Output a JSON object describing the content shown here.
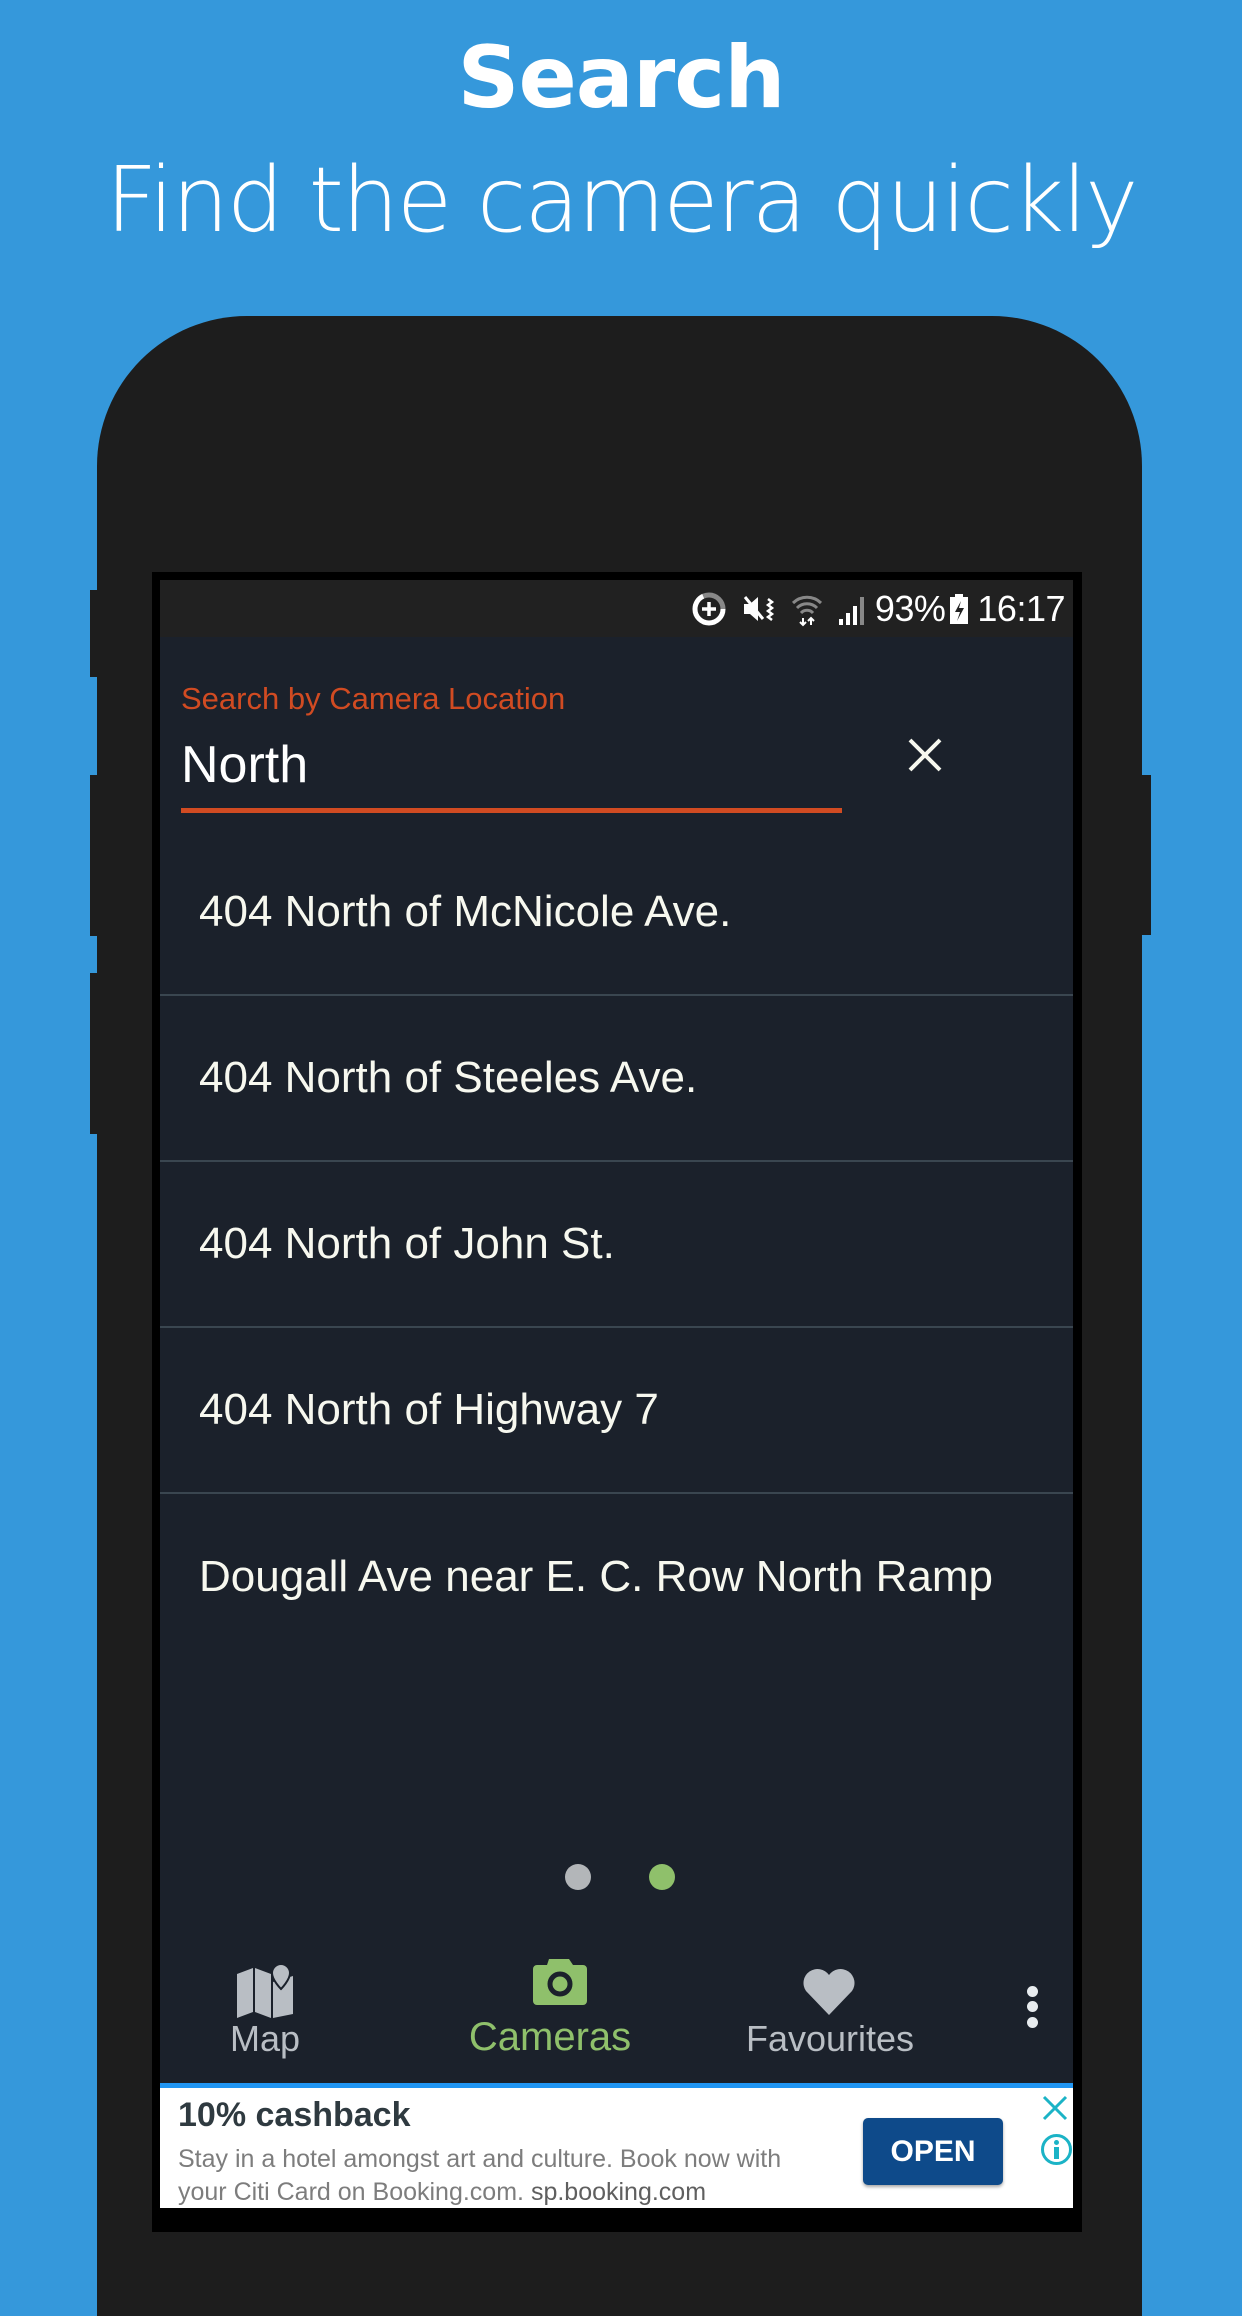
{
  "hero": {
    "title": "Search",
    "subtitle": "Find the camera quickly"
  },
  "status_bar": {
    "icons": [
      "data-saver-icon",
      "mute-vibrate-icon",
      "wifi-icon",
      "signal-icon",
      "battery-charging-icon"
    ],
    "battery": "93%",
    "time": "16:17"
  },
  "search": {
    "label": "Search by Camera Location",
    "value": "North",
    "clear_icon": "close-icon",
    "accent_color": "#d14b22"
  },
  "results": [
    "404 North of McNicole Ave.",
    "404 North of Steeles Ave.",
    "404 North of John St.",
    "404 North of Highway 7",
    "Dougall Ave near E. C. Row North Ramp"
  ],
  "pager": {
    "pages": 2,
    "active_page": 2,
    "inactive_color": "#b3b6b9",
    "active_color": "#8fc06b"
  },
  "bottom_nav": {
    "items": [
      {
        "label": "Map",
        "icon": "map-icon",
        "active": false
      },
      {
        "label": "Cameras",
        "icon": "camera-icon",
        "active": true
      },
      {
        "label": "Favourites",
        "icon": "heart-icon",
        "active": false
      }
    ],
    "more_icon": "more-vertical-icon"
  },
  "ad": {
    "title": "10% cashback",
    "body": "Stay in a hotel amongst art and culture. Book now with your Citi Card on Booking.com.",
    "url": "sp.booking.com",
    "cta": "OPEN",
    "close_icon": "close-icon",
    "info_icon": "info-icon"
  },
  "colors": {
    "background": "#3598db",
    "screen": "#1b212b",
    "active": "#8fc06b",
    "ad_button": "#0e4a8a"
  }
}
